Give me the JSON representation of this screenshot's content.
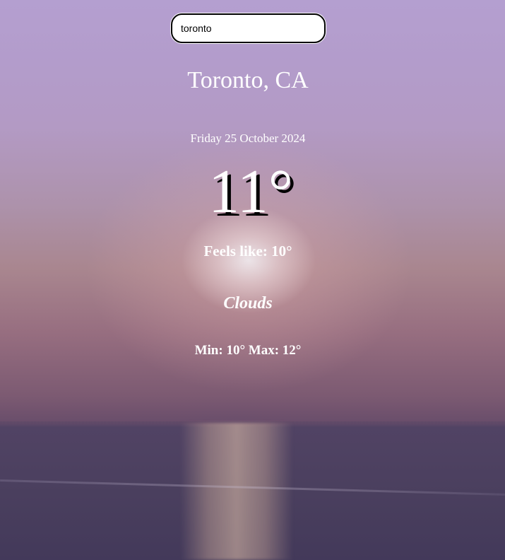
{
  "search": {
    "value": "toronto",
    "placeholder": ""
  },
  "weather": {
    "location": "Toronto, CA",
    "date": "Friday 25 October 2024",
    "temperature": "11°",
    "feels_like": "Feels like: 10°",
    "condition": "Clouds",
    "min_max": "Min: 10° Max: 12°"
  },
  "colors": {
    "text": "#ffffff",
    "temp_shadow": "#000000",
    "sky_top": "#b49fd0",
    "sea": "#4a3f5e"
  }
}
